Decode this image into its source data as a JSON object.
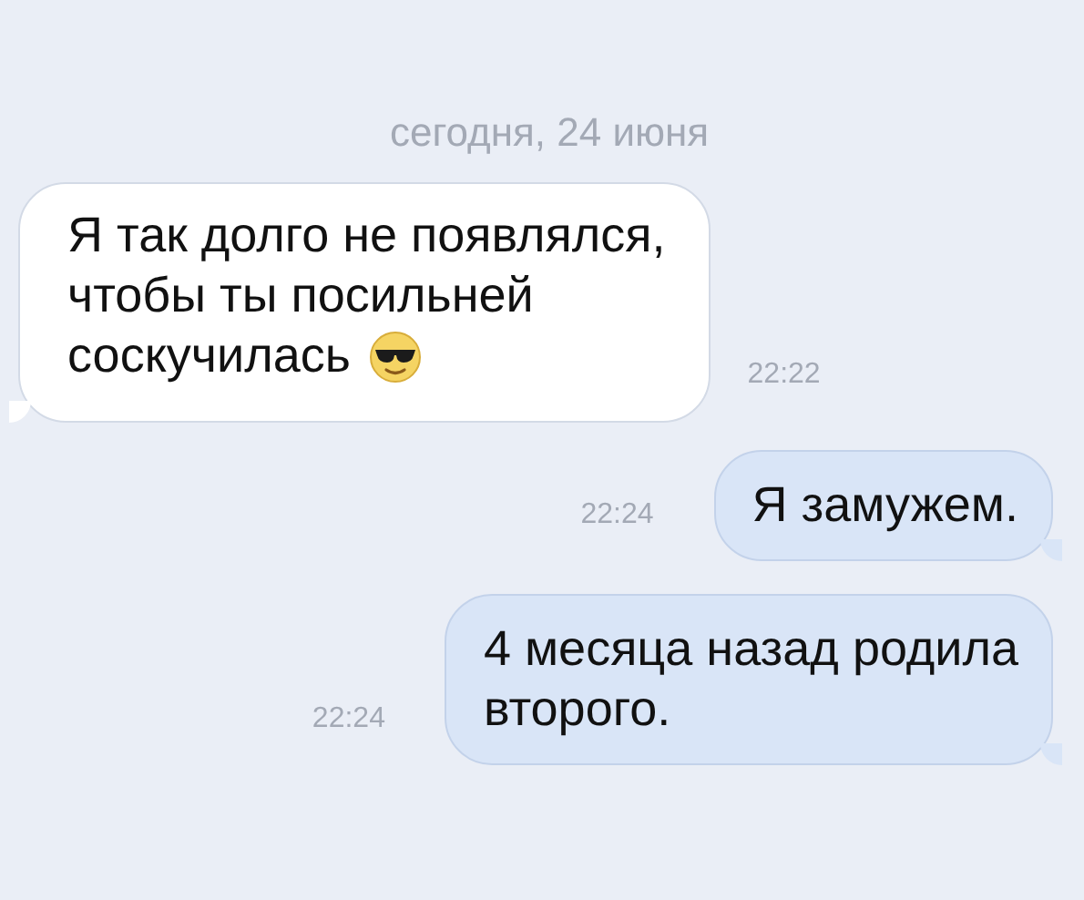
{
  "date_separator": "сегодня, 24 июня",
  "messages": [
    {
      "kind": "incoming",
      "lines": [
        "Я так долго не появлялся,",
        "чтобы ты посильней",
        "соскучилась"
      ],
      "emoji": true,
      "time": "22:22"
    },
    {
      "kind": "outgoing",
      "lines": [
        "Я замужем."
      ],
      "emoji": false,
      "time": "22:24"
    },
    {
      "kind": "outgoing",
      "lines": [
        "4 месяца назад родила",
        "второго."
      ],
      "emoji": false,
      "time": "22:24"
    }
  ]
}
